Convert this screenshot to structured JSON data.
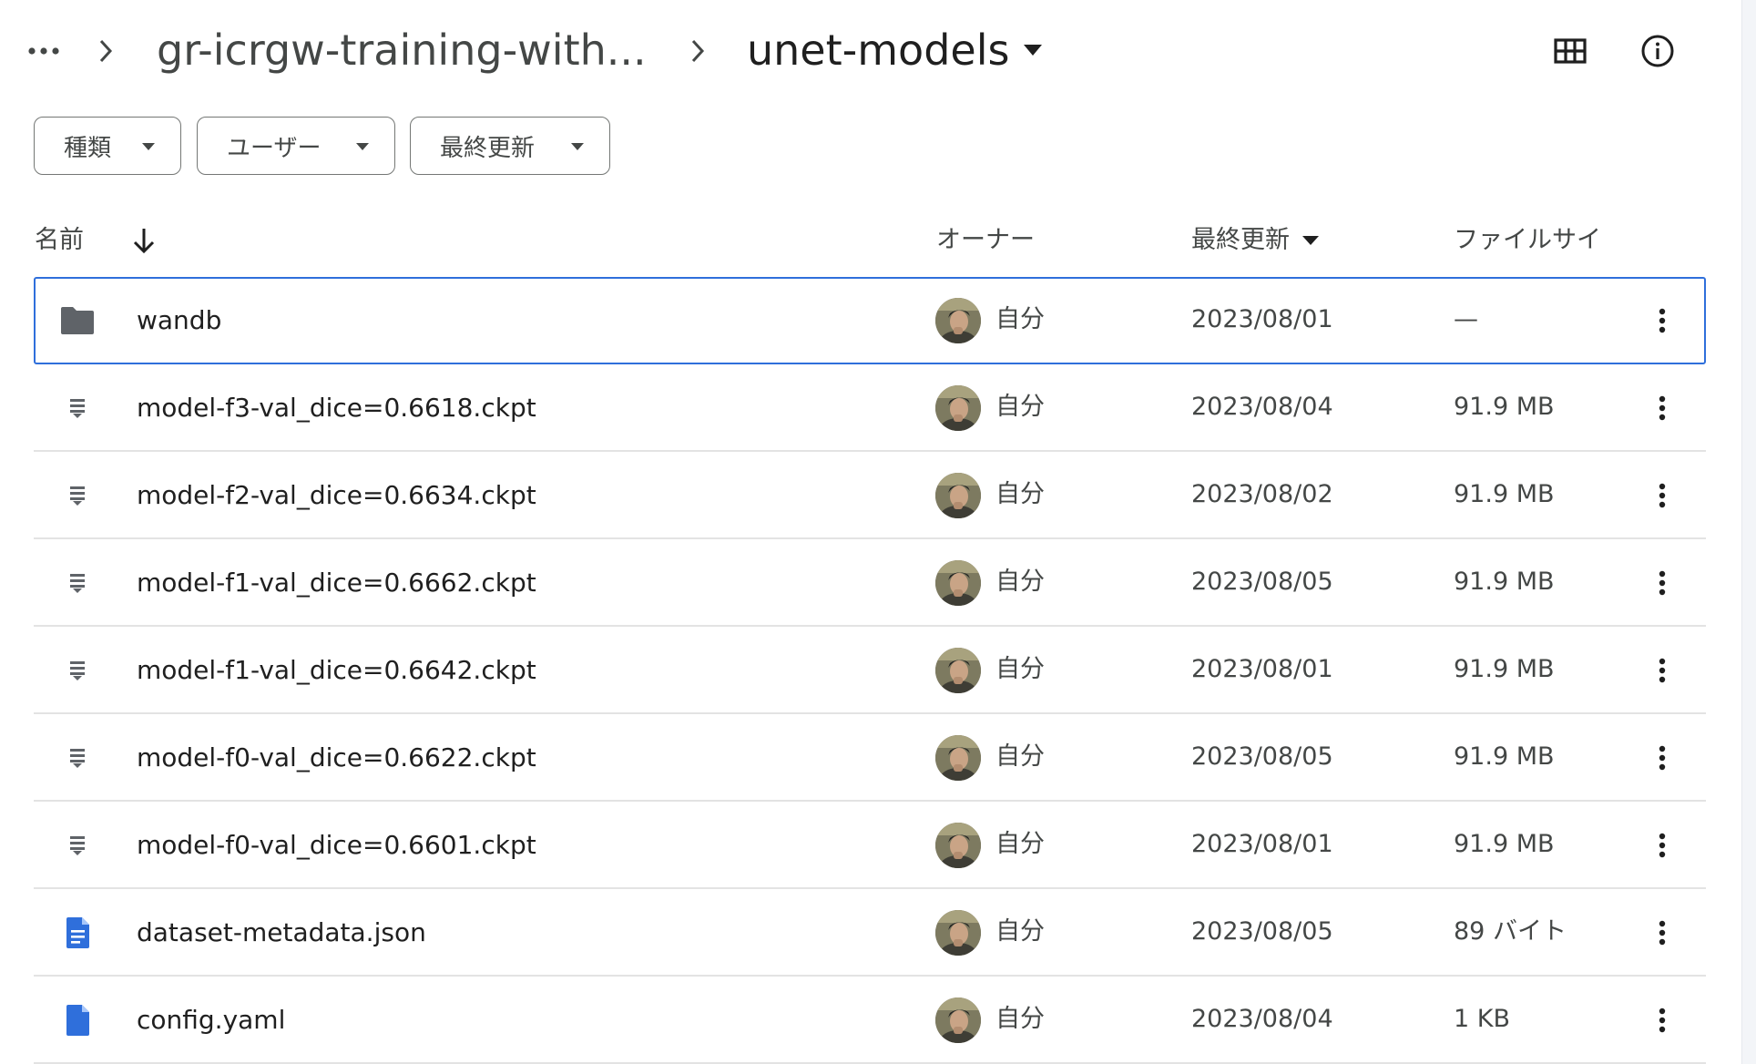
{
  "breadcrumb": {
    "overflow_icon": "more-horiz-icon",
    "parent": "gr-icrgw-training-with...",
    "current": "unet-models"
  },
  "toolbar": {
    "grid_view_icon": "grid-view-icon",
    "info_icon": "info-icon"
  },
  "filters": [
    {
      "label": "種類"
    },
    {
      "label": "ユーザー"
    },
    {
      "label": "最終更新"
    }
  ],
  "columns": {
    "name": "名前",
    "owner": "オーナー",
    "modified": "最終更新",
    "size": "ファイルサイ"
  },
  "colors": {
    "selection_border": "#2f6fdb",
    "doc_icon": "#2f6fdb",
    "folder_icon": "#5f6368"
  },
  "files": [
    {
      "name": "wandb",
      "type": "folder",
      "icon": "folder-icon",
      "owner": "自分",
      "modified": "2023/08/01",
      "size": "—",
      "selected": true
    },
    {
      "name": "model-f3-val_dice=0.6618.ckpt",
      "type": "binary",
      "icon": "binary-file-icon",
      "owner": "自分",
      "modified": "2023/08/04",
      "size": "91.9 MB"
    },
    {
      "name": "model-f2-val_dice=0.6634.ckpt",
      "type": "binary",
      "icon": "binary-file-icon",
      "owner": "自分",
      "modified": "2023/08/02",
      "size": "91.9 MB"
    },
    {
      "name": "model-f1-val_dice=0.6662.ckpt",
      "type": "binary",
      "icon": "binary-file-icon",
      "owner": "自分",
      "modified": "2023/08/05",
      "size": "91.9 MB"
    },
    {
      "name": "model-f1-val_dice=0.6642.ckpt",
      "type": "binary",
      "icon": "binary-file-icon",
      "owner": "自分",
      "modified": "2023/08/01",
      "size": "91.9 MB"
    },
    {
      "name": "model-f0-val_dice=0.6622.ckpt",
      "type": "binary",
      "icon": "binary-file-icon",
      "owner": "自分",
      "modified": "2023/08/05",
      "size": "91.9 MB"
    },
    {
      "name": "model-f0-val_dice=0.6601.ckpt",
      "type": "binary",
      "icon": "binary-file-icon",
      "owner": "自分",
      "modified": "2023/08/01",
      "size": "91.9 MB"
    },
    {
      "name": "dataset-metadata.json",
      "type": "doc",
      "icon": "document-icon",
      "owner": "自分",
      "modified": "2023/08/05",
      "size": "89 バイト"
    },
    {
      "name": "config.yaml",
      "type": "doc-plain",
      "icon": "file-icon",
      "owner": "自分",
      "modified": "2023/08/04",
      "size": "1 KB"
    }
  ]
}
